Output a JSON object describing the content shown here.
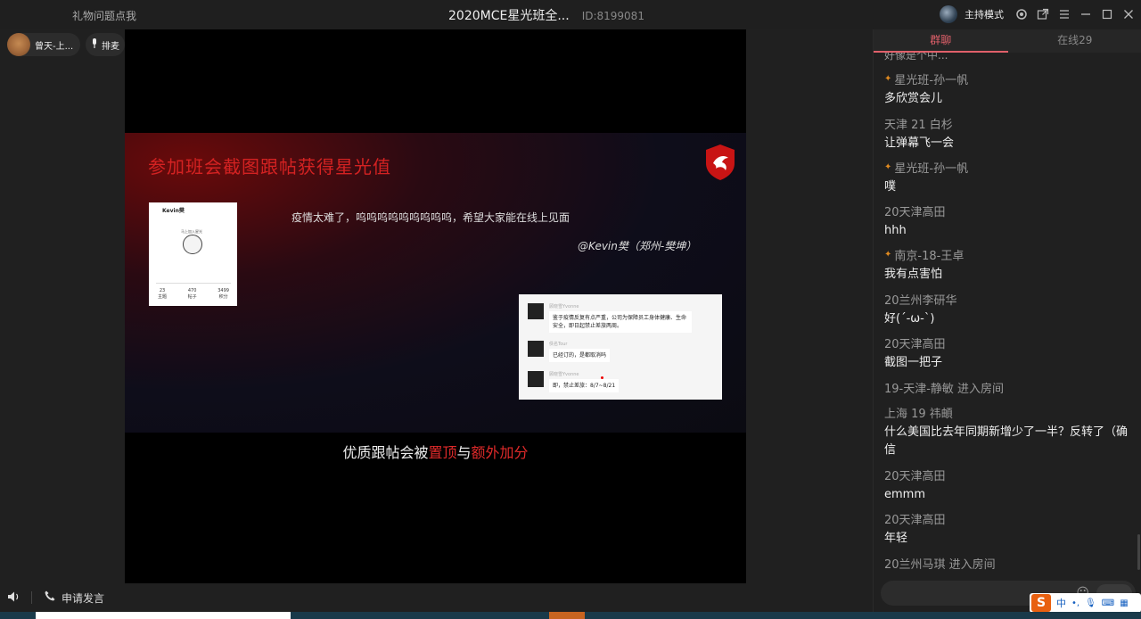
{
  "top": {
    "gift_link": "礼物问题点我",
    "room_title": "2020MCE星光班全...",
    "room_id": "ID:8199081",
    "host_mode": "主持模式"
  },
  "left": {
    "user_name": "曾天-上...",
    "mic_label": "排麦"
  },
  "slide": {
    "title": "参加班会截图跟帖获得星光值",
    "profile_name": "Kevin樊",
    "profile_caption": "马上加入星光",
    "stats": [
      {
        "value": "23",
        "label": "主题"
      },
      {
        "value": "470",
        "label": "帖子"
      },
      {
        "value": "3499",
        "label": "积分"
      }
    ],
    "quote": "疫情太难了，呜呜呜呜呜呜呜呜呜，希望大家能在线上见面",
    "author": "@Kevin樊（郑州-樊坤）",
    "chat_rows": [
      {
        "name": "顾晓雪Yvonne",
        "text": "鉴于疫情反复有点严重，公司为保障员工身体健康、生命安全，即日起禁止差旅两周。"
      },
      {
        "name": "佚名Tour",
        "text": "已经订的，是都取消吗"
      },
      {
        "name": "顾晓雪Yvonne",
        "text": "即，禁止差旅：8/7~8/21"
      }
    ],
    "bottom_prefix": "优质跟帖会被",
    "bottom_hl1": "置顶",
    "bottom_mid": "与",
    "bottom_hl2": "额外加分"
  },
  "bottom": {
    "apply_label": "申请发言"
  },
  "chat": {
    "tab_group": "群聊",
    "tab_online": "在线29",
    "cutoff": "好像是个中...",
    "messages": [
      {
        "name": "星光班-孙一帆",
        "badge": true,
        "text": "多欣赏会儿"
      },
      {
        "name": "天津 21 白杉",
        "badge": false,
        "text": "让弹幕飞一会"
      },
      {
        "name": "星光班-孙一帆",
        "badge": true,
        "text": "噗"
      },
      {
        "name": "20天津高田",
        "badge": false,
        "text": "hhh"
      },
      {
        "name": "南京-18-王卓",
        "badge": true,
        "text": "我有点害怕"
      },
      {
        "name": "20兰州李研华",
        "badge": false,
        "text": "好(´-ω-`)"
      },
      {
        "name": "20天津高田",
        "badge": false,
        "text": "截图一把子"
      },
      {
        "name": "19-天津-静敏 进入房间",
        "badge": false,
        "text": ""
      },
      {
        "name": "上海 19 祎頔",
        "badge": false,
        "text": "什么美国比去年同期新增少了一半？反转了（确信"
      },
      {
        "name": "20天津高田",
        "badge": false,
        "text": "emmm"
      },
      {
        "name": "20天津高田",
        "badge": false,
        "text": "年轻"
      },
      {
        "name": "20兰州马琪 进入房间",
        "badge": false,
        "text": ""
      }
    ]
  },
  "ime": {
    "logo": "S",
    "lang": "中"
  }
}
